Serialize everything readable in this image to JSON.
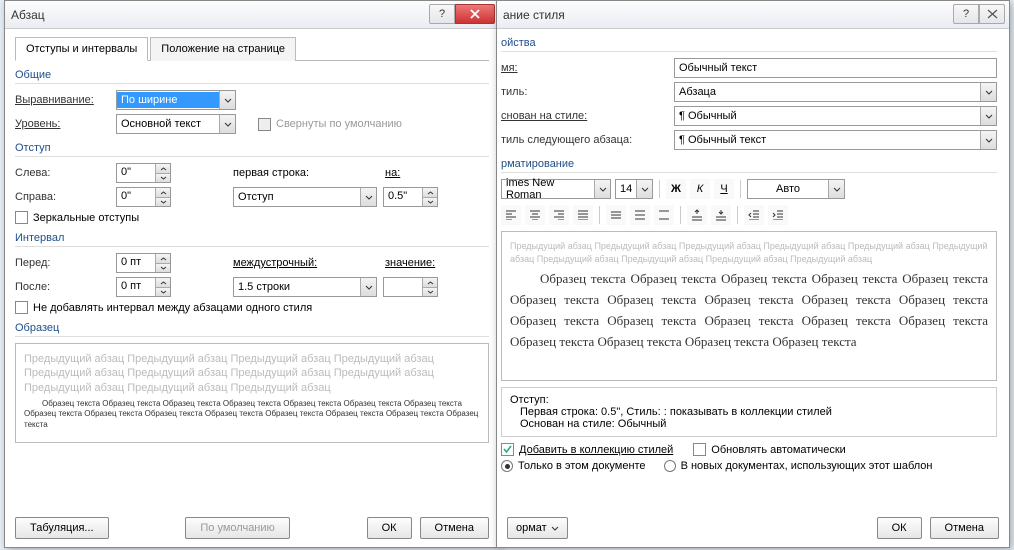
{
  "paragraph": {
    "title": "Абзац",
    "tabs": {
      "indents": "Отступы и интервалы",
      "position": "Положение на странице"
    },
    "general": {
      "label": "Общие",
      "alignment_label": "Выравнивание:",
      "alignment_value": "По ширине",
      "outline_label": "Уровень:",
      "outline_value": "Основной текст",
      "collapse_label": "Свернуты по умолчанию"
    },
    "indent": {
      "label": "Отступ",
      "left_label": "Слева:",
      "left_value": "0\"",
      "right_label": "Справа:",
      "right_value": "0\"",
      "firstline_label": "первая строка:",
      "firstline_value": "Отступ",
      "by_label": "на:",
      "by_value": "0.5\"",
      "mirror_label": "Зеркальные отступы"
    },
    "spacing": {
      "label": "Интервал",
      "before_label": "Перед:",
      "before_value": "0 пт",
      "after_label": "После:",
      "after_value": "0 пт",
      "linespacing_label": "междустрочный:",
      "linespacing_value": "1.5 строки",
      "at_label": "значение:",
      "at_value": "",
      "dontadd_label": "Не добавлять интервал между абзацами одного стиля"
    },
    "preview": {
      "label": "Образец",
      "gray_text": "Предыдущий абзац Предыдущий абзац Предыдущий абзац Предыдущий абзац Предыдущий абзац Предыдущий абзац Предыдущий абзац Предыдущий абзац Предыдущий абзац Предыдущий абзац Предыдущий абзац",
      "sample_text": "Образец текста Образец текста Образец текста Образец текста Образец текста Образец текста Образец текста Образец текста Образец текста Образец текста Образец текста Образец текста Образец текста Образец текста Образец текста"
    },
    "footer": {
      "tabs_btn": "Табуляция...",
      "default_btn": "По умолчанию",
      "ok": "ОК",
      "cancel": "Отмена"
    }
  },
  "style": {
    "title_suffix": "ание стиля",
    "props_label": "ойства",
    "name_label": "мя:",
    "name_value": "Обычный текст",
    "type_label": "тиль:",
    "type_value": "Абзаца",
    "based_label": "снован на стиле:",
    "based_value": "¶ Обычный",
    "next_label": "тиль следующего абзаца:",
    "next_value": "¶ Обычный текст",
    "formatting_label": "рматирование",
    "font_value": "imes New Roman",
    "size_value": "14",
    "bold": "Ж",
    "italic": "К",
    "underline": "Ч",
    "color_value": "Авто",
    "preview_gray": "Предыдущий абзац Предыдущий абзац Предыдущий абзац Предыдущий абзац Предыдущий абзац Предыдущий абзац Предыдущий абзац Предыдущий абзац Предыдущий абзац Предыдущий абзац",
    "preview_sample": "Образец текста Образец текста Образец текста Образец текста Образец текста Образец текста Образец текста Образец текста Образец текста Образец текста Образец текста Образец текста Образец текста Образец текста Образец текста Образец текста Образец текста Образец текста Образец текста",
    "desc_indent_label": "Отступ:",
    "desc_line1": "Первая строка:  0.5\", Стиль: : показывать в коллекции стилей",
    "desc_line2": "Основан на стиле: Обычный",
    "add_collection": "Добавить в коллекцию стилей",
    "auto_update": "Обновлять автоматически",
    "only_doc": "Только в этом документе",
    "new_docs": "В новых документах, использующих этот шаблон",
    "format_btn": "ормат",
    "ok": "ОК",
    "cancel": "Отмена"
  }
}
